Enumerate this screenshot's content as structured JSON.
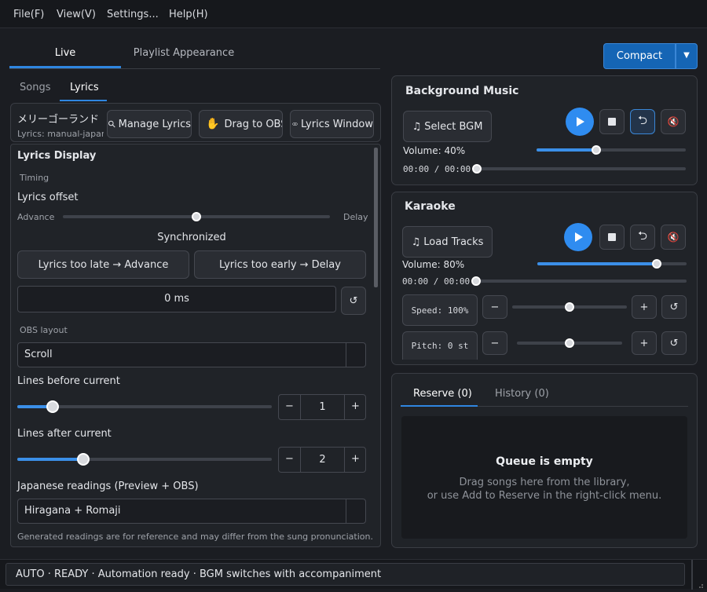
{
  "menu": {
    "file": "File(F)",
    "view": "View(V)",
    "settings": "Settings...",
    "help": "Help(H)"
  },
  "main_tabs": {
    "live": "Live",
    "playlist": "Playlist Appearance"
  },
  "compact_button": "Compact",
  "sub_tabs": {
    "songs": "Songs",
    "lyrics": "Lyrics"
  },
  "current_song": {
    "title": "メリーゴーランド",
    "source": "Lyrics: manual-japane"
  },
  "lyrics_toolbar": {
    "manage": "Manage Lyrics",
    "drag": "Drag to OBS",
    "window": "Lyrics Window"
  },
  "lyrics_display": {
    "heading": "Lyrics Display",
    "timing_label": "Timing",
    "offset_label": "Lyrics offset",
    "advance": "Advance",
    "delay": "Delay",
    "offset_slider_fraction": 0.5,
    "sync_status": "Synchronized",
    "late_button": "Lyrics too late → Advance",
    "early_button": "Lyrics too early → Delay",
    "offset_value": "0 ms",
    "obs_layout_label": "OBS layout",
    "obs_layout_value": "Scroll",
    "lines_before_label": "Lines before current",
    "lines_before_value": "1",
    "lines_before_fraction": 0.14,
    "lines_after_label": "Lines after current",
    "lines_after_value": "2",
    "lines_after_fraction": 0.26,
    "readings_label": "Japanese readings (Preview + OBS)",
    "readings_value": "Hiragana + Romaji",
    "readings_note": "Generated readings are for reference and may differ from the sung pronunciation."
  },
  "bgm": {
    "title": "Background Music",
    "select_button": "Select BGM",
    "volume": "Volume: 40%",
    "volume_fraction": 0.4,
    "time": "00:00 / 00:00"
  },
  "karaoke": {
    "title": "Karaoke",
    "load_button": "Load Tracks",
    "volume": "Volume: 80%",
    "volume_fraction": 0.8,
    "time": "00:00 / 00:00",
    "speed": "Speed: 100%",
    "speed_fraction": 0.5,
    "pitch": "Pitch: 0 st",
    "pitch_fraction": 0.5
  },
  "queue": {
    "reserve_tab": "Reserve (0)",
    "history_tab": "History (0)",
    "empty_title": "Queue is empty",
    "empty_line1": "Drag songs here from the library,",
    "empty_line2": "or use Add to Reserve in the right-click menu."
  },
  "status": "AUTO · READY · Automation ready · BGM switches with accompaniment",
  "colors": {
    "accent": "#2f8cf0",
    "background": "#1b1d22",
    "panel": "#202328"
  }
}
